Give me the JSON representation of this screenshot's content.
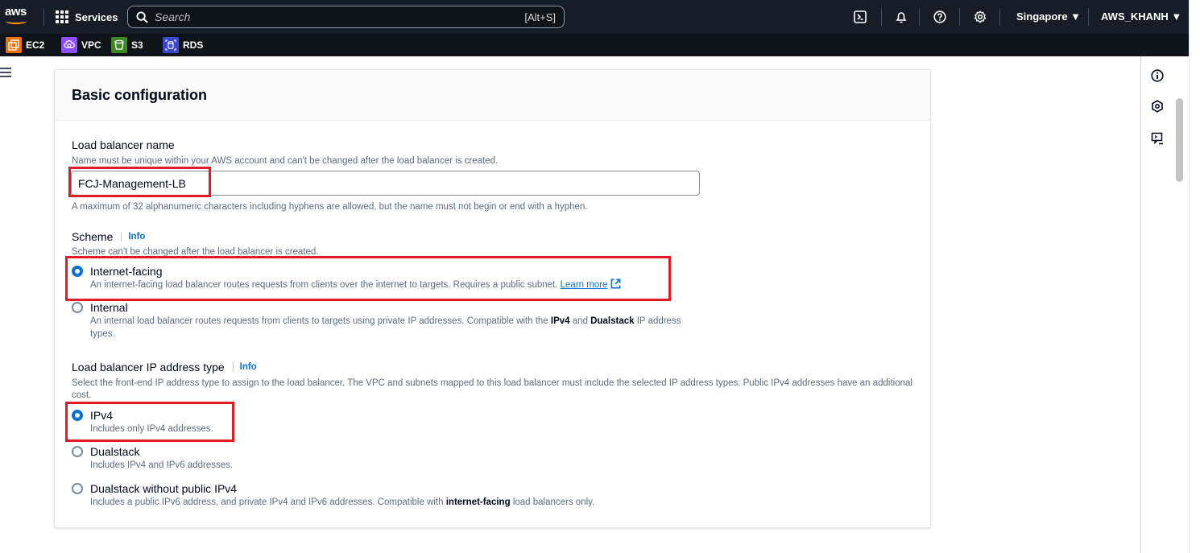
{
  "topnav": {
    "logo_text": "aws",
    "services_label": "Services",
    "search_placeholder": "Search",
    "search_shortcut": "[Alt+S]",
    "region": "Singapore ▼",
    "account": "AWS_KHANH ▼"
  },
  "favorites": [
    {
      "label": "EC2",
      "color": "#ed7100"
    },
    {
      "label": "VPC",
      "color": "#8c4fff"
    },
    {
      "label": "S3",
      "color": "#3f8624"
    },
    {
      "label": "RDS",
      "color": "#3b48cc"
    }
  ],
  "panel": {
    "title": "Basic configuration",
    "name_section": {
      "label": "Load balancer name",
      "description": "Name must be unique within your AWS account and can't be changed after the load balancer is created.",
      "value": "FCJ-Management-LB",
      "constraint": "A maximum of 32 alphanumeric characters including hyphens are allowed, but the name must not begin or end with a hyphen."
    },
    "scheme_section": {
      "label": "Scheme",
      "info": "Info",
      "description": "Scheme can't be changed after the load balancer is created.",
      "options": [
        {
          "label": "Internet-facing",
          "desc": "An internet-facing load balancer routes requests from clients over the internet to targets. Requires a public subnet.",
          "link": "Learn more",
          "selected": true
        },
        {
          "label": "Internal",
          "desc_1": "An internal load balancer routes requests from clients to targets using private IP addresses. Compatible with the",
          "bold_1": "IPv4",
          "desc_2": "and",
          "bold_2": "Dualstack",
          "desc_3": "IP address types.",
          "selected": false
        }
      ]
    },
    "ip_section": {
      "label": "Load balancer IP address type",
      "info": "Info",
      "description": "Select the front-end IP address type to assign to the load balancer. The VPC and subnets mapped to this load balancer must include the selected IP address types. Public IPv4 addresses have an additional cost.",
      "options": [
        {
          "label": "IPv4",
          "desc": "Includes only IPv4 addresses.",
          "selected": true
        },
        {
          "label": "Dualstack",
          "desc": "Includes IPv4 and IPv6 addresses.",
          "selected": false
        },
        {
          "label": "Dualstack without public IPv4",
          "desc_1": "Includes a public IPv6 address, and private IPv4 and IPv6 addresses. Compatible with",
          "bold": "internet-facing",
          "desc_2": "load balancers only.",
          "selected": false
        }
      ]
    }
  },
  "colors": {
    "nav_bg": "#161d26",
    "accent_blue": "#0972d3",
    "highlight_red": "#e01b24",
    "aws_orange": "#ff9900"
  }
}
